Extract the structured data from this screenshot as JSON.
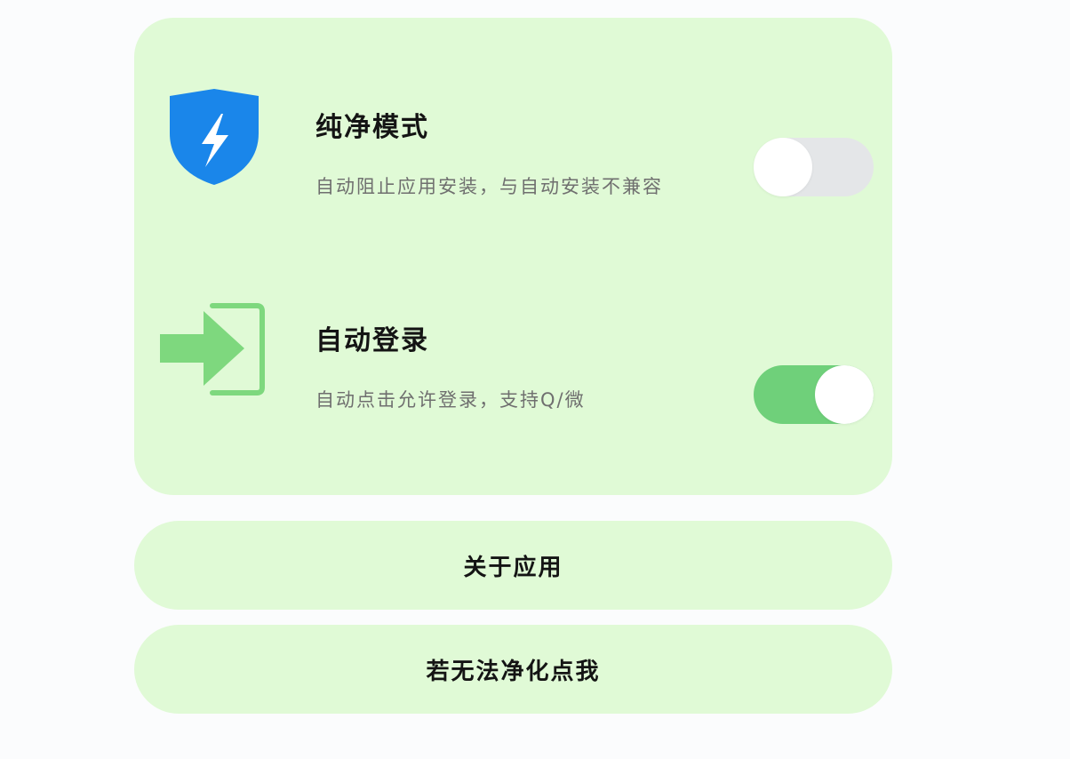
{
  "settings": {
    "pure_mode": {
      "title": "纯净模式",
      "description": "自动阻止应用安装，与自动安装不兼容",
      "enabled": false,
      "icon": "shield-lightning-icon"
    },
    "auto_login": {
      "title": "自动登录",
      "description": "自动点击允许登录，支持Q/微",
      "enabled": true,
      "icon": "login-arrow-icon"
    }
  },
  "buttons": {
    "about": "关于应用",
    "cannot_clean": "若无法净化点我"
  },
  "colors": {
    "card_background": "#e0fad6",
    "toggle_on": "#6fd07a",
    "toggle_off": "#e4e6e8",
    "shield_blue": "#1a86ea",
    "login_green": "#7ed87e"
  }
}
